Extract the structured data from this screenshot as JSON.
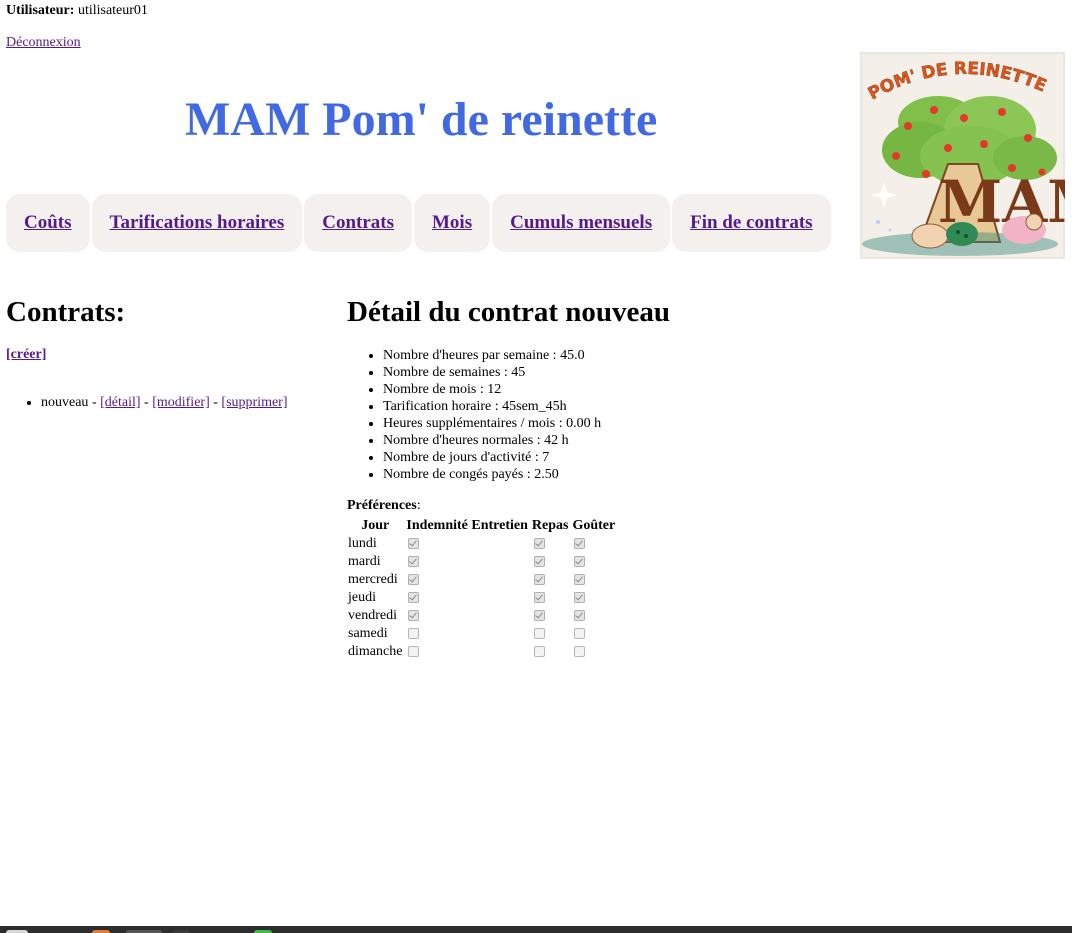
{
  "header": {
    "user_label": "Utilisateur:",
    "username": "utilisateur01",
    "logout": "Déconnexion"
  },
  "app_title": "MAM Pom' de reinette",
  "logo": {
    "text": "POM' DE REINETTE",
    "letters": "MAM",
    "icon": "apple-tree-logo-icon"
  },
  "nav": [
    {
      "label": "Coûts"
    },
    {
      "label": "Tarifications horaires"
    },
    {
      "label": "Contrats"
    },
    {
      "label": "Mois"
    },
    {
      "label": "Cumuls mensuels"
    },
    {
      "label": "Fin de contrats"
    }
  ],
  "contracts": {
    "heading": "Contrats:",
    "create": "[créer]",
    "items": [
      {
        "name": "nouveau",
        "sep1": " - ",
        "detail": "[détail]",
        "sep2": " - ",
        "modify": "[modifier]",
        "sep3": " - ",
        "delete": "[supprimer]"
      }
    ]
  },
  "detail": {
    "heading": "Détail du contrat nouveau",
    "items": [
      "Nombre d'heures par semaine : 45.0",
      "Nombre de semaines : 45",
      "Nombre de mois : 12",
      "Tarification horaire : 45sem_45h",
      "Heures supplémentaires / mois : 0.00 h",
      "Nombre d'heures normales : 42 h",
      "Nombre de jours d'activité : 7",
      "Nombre de congés payés : 2.50"
    ],
    "prefs_label": "Préférences",
    "prefs_colon": ":",
    "prefs_columns": [
      "Jour",
      "Indemnité Entretien",
      "Repas",
      "Goûter"
    ],
    "prefs_rows": [
      {
        "day": "lundi",
        "indemnite": true,
        "repas": true,
        "gouter": true
      },
      {
        "day": "mardi",
        "indemnite": true,
        "repas": true,
        "gouter": true
      },
      {
        "day": "mercredi",
        "indemnite": true,
        "repas": true,
        "gouter": true
      },
      {
        "day": "jeudi",
        "indemnite": true,
        "repas": true,
        "gouter": true
      },
      {
        "day": "vendredi",
        "indemnite": true,
        "repas": true,
        "gouter": true
      },
      {
        "day": "samedi",
        "indemnite": false,
        "repas": false,
        "gouter": false
      },
      {
        "day": "dimanche",
        "indemnite": false,
        "repas": false,
        "gouter": false
      }
    ]
  },
  "colors": {
    "title": "#4169e1",
    "link": "#551a8b",
    "nav_bg": "#f3f0ee",
    "taskbar": "#2d2d2d"
  }
}
